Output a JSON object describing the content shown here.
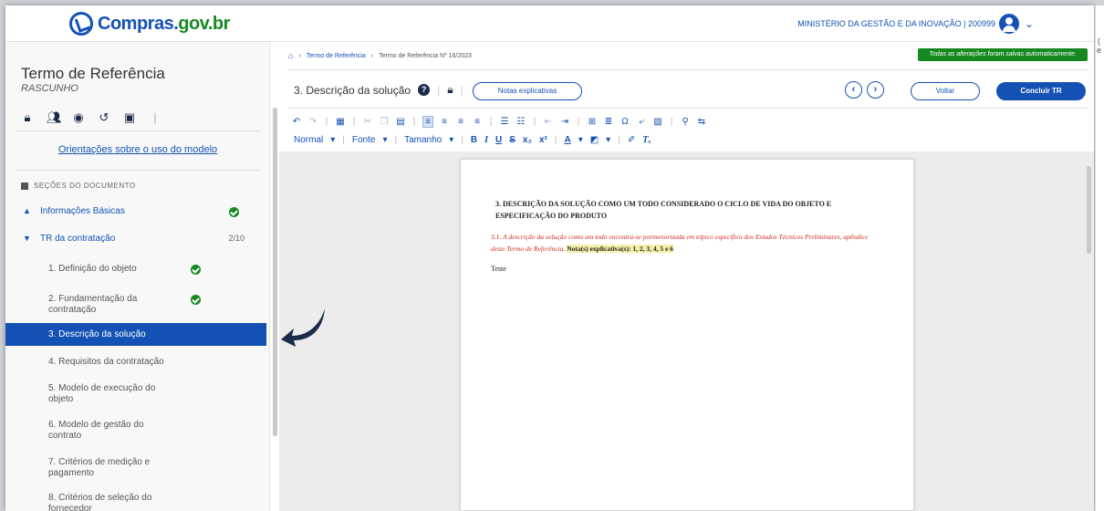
{
  "header": {
    "logo_main": "Compras.",
    "logo_suffix": "gov.br",
    "org": "MINISTÉRIO DA GESTÃO E DA INOVAÇÃO | 200999",
    "caret": "⌄"
  },
  "sidebar": {
    "title": "Termo de Referência",
    "status": "RASCUNHO",
    "guide_link": "Orientações sobre o uso do modelo",
    "sections_label": "SEÇÕES DO DOCUMENTO",
    "groups": [
      {
        "label": "Informações Básicas",
        "arrow": "▲",
        "done": true
      },
      {
        "label": "TR da contratação",
        "arrow": "▼",
        "count": "2/10"
      }
    ],
    "items": [
      {
        "label": "1. Definição do objeto",
        "done": true
      },
      {
        "label": "2. Fundamentação da contratação",
        "done": true
      },
      {
        "label": "3. Descrição da solução",
        "active": true
      },
      {
        "label": "4. Requisitos da contratação"
      },
      {
        "label": "5. Modelo de execução do objeto"
      },
      {
        "label": "6. Modelo de gestão do contrato"
      },
      {
        "label": "7. Critérios de medição e pagamento"
      },
      {
        "label": "8. Critérios de seleção do fornecedor"
      }
    ]
  },
  "breadcrumb": {
    "link": "Termo de Referência",
    "current": "Termo de Referência Nº 16/2023"
  },
  "autosave": "Todas as alterações foram salvas automaticamente.",
  "section": {
    "title": "3. Descrição da solução",
    "notes_button": "Notas explicativas",
    "back_button": "Voltar",
    "finish_button": "Concluir TR"
  },
  "toolbar2": {
    "format": "Normal",
    "font": "Fonte",
    "size": "Tamanho"
  },
  "document": {
    "heading": "3. DESCRIÇÃO DA SOLUÇÃO COMO UM TODO CONSIDERADO O CICLO DE VIDA DO OBJETO E ESPECIFICAÇÃO DO PRODUTO",
    "para_num": "3.1. ",
    "para_text": "A descrição da solução como um todo encontra-se pormenorizada em tópico específico dos Estudos Técnicos Preliminares, apêndice deste Termo de Referência.",
    "nota": "Nota(s) explicativa(s): 1, 2, 3, 4, 5 e 6",
    "body": "Teste"
  },
  "colors": {
    "primary": "#1351b4",
    "success": "#168821",
    "required_text": "#d1281f"
  }
}
